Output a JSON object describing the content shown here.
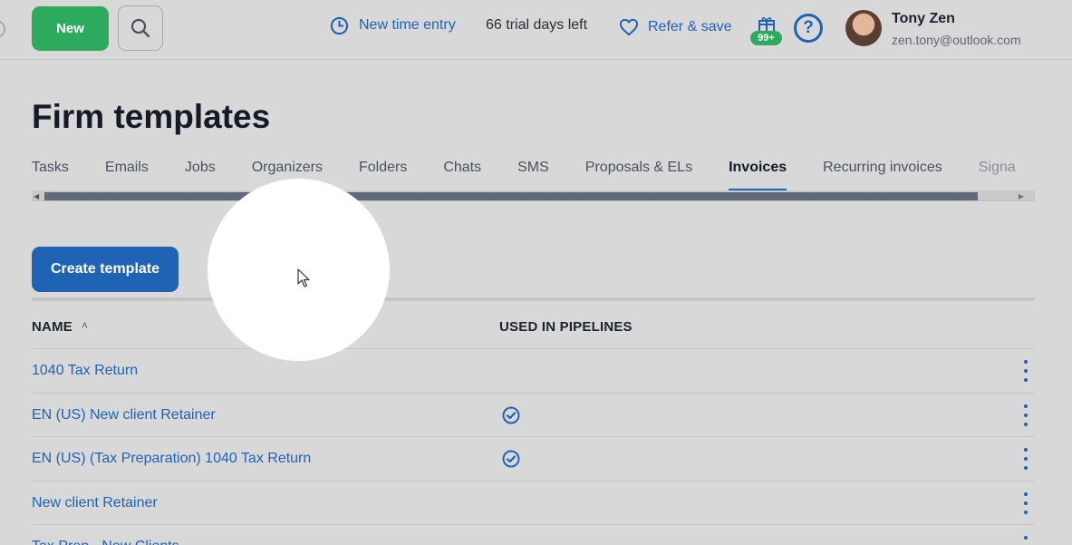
{
  "header": {
    "new_button": "New",
    "time_entry": "New time entry",
    "trial_text": "66 trial days left",
    "refer": "Refer & save",
    "notifications_badge": "99+",
    "help_label": "?",
    "user": {
      "name": "Tony Zen",
      "email": "zen.tony@outlook.com"
    }
  },
  "page": {
    "title": "Firm templates"
  },
  "tabs": [
    {
      "label": "Tasks"
    },
    {
      "label": "Emails"
    },
    {
      "label": "Jobs"
    },
    {
      "label": "Organizers"
    },
    {
      "label": "Folders"
    },
    {
      "label": "Chats"
    },
    {
      "label": "SMS"
    },
    {
      "label": "Proposals & ELs"
    },
    {
      "label": "Invoices",
      "active": true
    },
    {
      "label": "Recurring invoices"
    },
    {
      "label": "Signa"
    }
  ],
  "actions": {
    "create_template": "Create template"
  },
  "table": {
    "columns": {
      "name": "NAME",
      "sort_indicator": "˄",
      "used_in_pipelines": "USED IN PIPELINES"
    },
    "rows": [
      {
        "name": "1040 Tax Return",
        "used_in_pipelines": false
      },
      {
        "name": "EN (US) New client Retainer",
        "used_in_pipelines": true
      },
      {
        "name": "EN (US) (Tax Preparation) 1040 Tax Return",
        "used_in_pipelines": true
      },
      {
        "name": "New client Retainer",
        "used_in_pipelines": false
      },
      {
        "name": "Tax Prep - New Clients",
        "used_in_pipelines": false
      }
    ]
  },
  "colors": {
    "accent_blue": "#1f63b5",
    "accent_green": "#2eaa5f",
    "background": "#d8d8d8"
  },
  "icons": [
    "search-icon",
    "clock-icon",
    "heart-icon",
    "gift-icon",
    "help-icon",
    "check-circle-icon",
    "kebab-menu-icon",
    "cursor-icon"
  ]
}
